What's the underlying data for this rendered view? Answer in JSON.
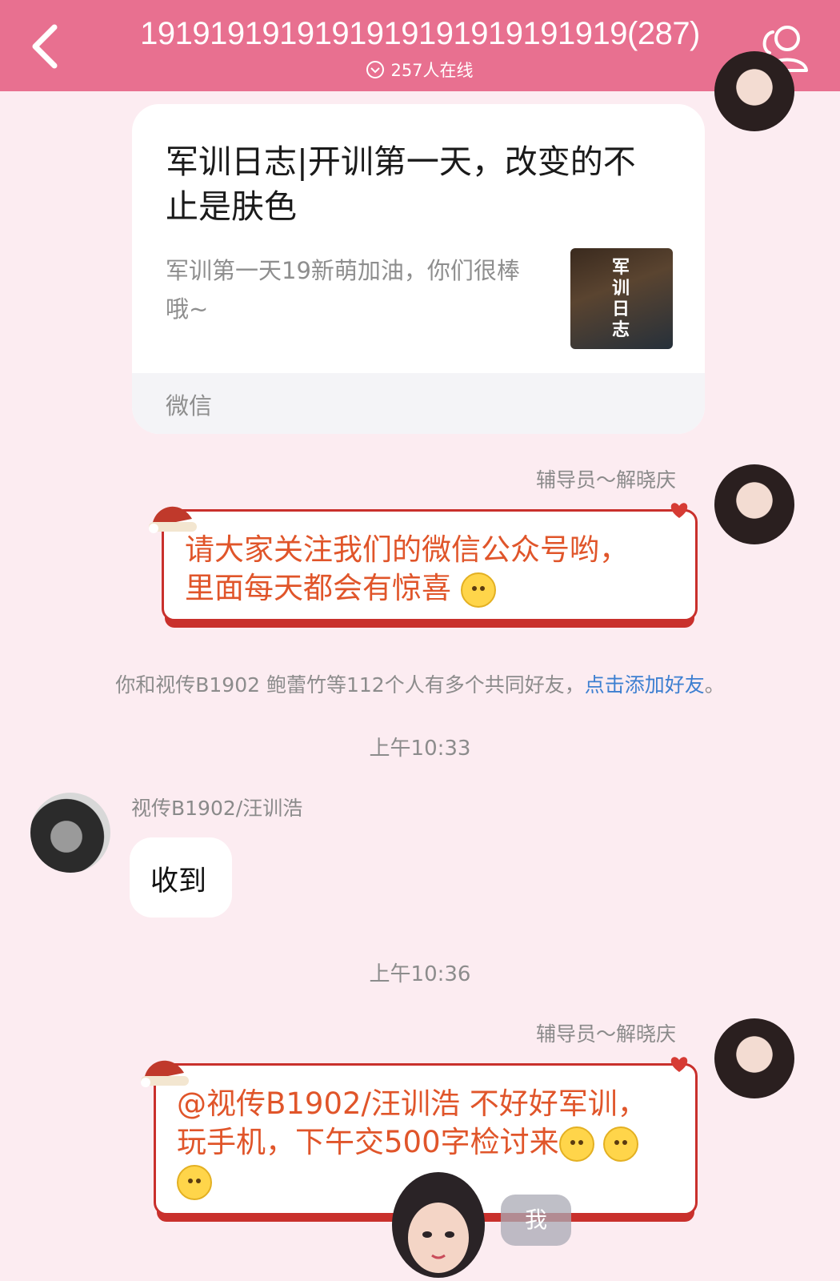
{
  "header": {
    "title": "1919191919191919191919191919(287)",
    "online_count": "257人在线",
    "icons": {
      "back": "chevron-left-icon",
      "members": "group-members-icon"
    }
  },
  "colors": {
    "header_bg": "#e87090",
    "page_bg": "#fcecf1",
    "festive_text": "#e0552a",
    "link_blue": "#3d7fd1"
  },
  "link_card": {
    "title": "军训日志|开训第一天，改变的不止是肤色",
    "description": "军训第一天19新萌加油，你们很棒哦~",
    "thumbnail_text": "军训日志",
    "source": "微信"
  },
  "messages": [
    {
      "sender": "辅导员～解晓庆",
      "text_line1": "请大家关注我们的微信公众号哟，",
      "text_line2": "里面每天都会有惊喜"
    },
    {
      "sender": "视传B1902/汪训浩",
      "text": "收到"
    },
    {
      "sender": "辅导员～解晓庆",
      "text_line1": "@视传B1902/汪训浩 不好好军训，",
      "text_line2": "玩手机，下午交500字检讨来"
    }
  ],
  "system": {
    "mutual_friends": "你和视传B1902 鲍蕾竹等112个人有多个共同好友，",
    "add_friend_link": "点击添加好友",
    "period": "。"
  },
  "times": [
    "上午10:33",
    "上午10:36"
  ],
  "me_button": "我"
}
